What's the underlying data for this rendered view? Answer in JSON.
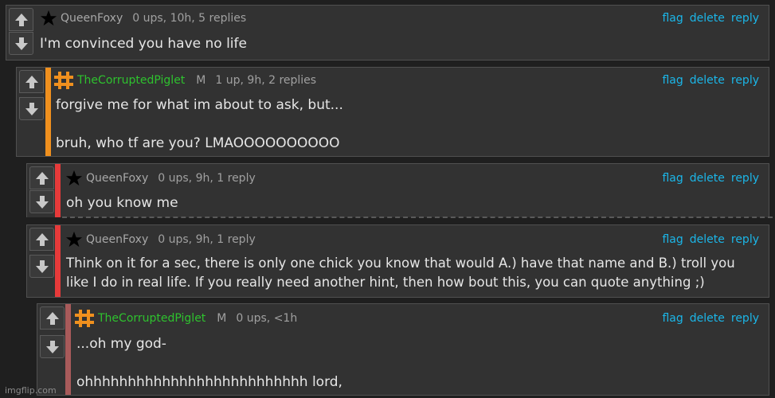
{
  "actions": {
    "flag": "flag",
    "delete": "delete",
    "reply": "reply"
  },
  "comments": [
    {
      "user": "QueenFoxy",
      "badge": "",
      "meta": "0 ups, 10h, 5 replies",
      "text": "I'm convinced you have no life",
      "bar_color": "",
      "user_color": "#a8a8a8",
      "icon": "star-icon"
    },
    {
      "user": "TheCorruptedPiglet",
      "badge": "M",
      "meta": "1 up, 9h, 2 replies",
      "text": "forgive me for what im about to ask, but...\n\nbruh, who tf are you? LMAOOOOOOOOOO",
      "bar_color": "#f0901e",
      "user_color": "#2ec22e",
      "icon": "pig-logo-icon"
    },
    {
      "user": "QueenFoxy",
      "badge": "",
      "meta": "0 ups, 9h, 1 reply",
      "text": "oh you know me",
      "bar_color": "#e63a3a",
      "user_color": "#a8a8a8",
      "icon": "star-icon"
    },
    {
      "user": "QueenFoxy",
      "badge": "",
      "meta": "0 ups, 9h, 1 reply",
      "text": "Think on it for a sec, there is only one chick you know that would A.) have that name and B.) troll you like I do in real life. If you really need another hint, then how bout this, you can quote anything ;)",
      "bar_color": "#e63a3a",
      "user_color": "#a8a8a8",
      "icon": "star-icon"
    },
    {
      "user": "TheCorruptedPiglet",
      "badge": "M",
      "meta": "0 ups, <1h",
      "text": "...oh my god-\n\nohhhhhhhhhhhhhhhhhhhhhhhhhh lord,",
      "bar_color": "#a85a5a",
      "user_color": "#2ec22e",
      "icon": "pig-logo-icon"
    }
  ],
  "watermark": "imgflip.com"
}
